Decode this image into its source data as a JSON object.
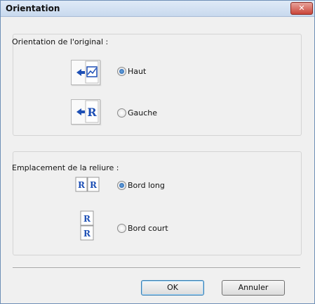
{
  "window": {
    "title": "Orientation",
    "close_label": "✕"
  },
  "original_orientation": {
    "label": "Orientation de l'original :",
    "options": [
      {
        "label": "Haut",
        "selected": true,
        "icon": "orientation-top-icon"
      },
      {
        "label": "Gauche",
        "selected": false,
        "icon": "orientation-left-icon"
      }
    ]
  },
  "binding_location": {
    "label": "Emplacement de la reliure :",
    "options": [
      {
        "label": "Bord long",
        "selected": true,
        "icon": "long-edge-binding-icon"
      },
      {
        "label": "Bord court",
        "selected": false,
        "icon": "short-edge-binding-icon"
      }
    ]
  },
  "buttons": {
    "ok": "OK",
    "cancel": "Annuler"
  },
  "colors": {
    "accent": "#1d4fb5",
    "title_gradient_top": "#dfeaf7",
    "close_red": "#c9453a"
  }
}
